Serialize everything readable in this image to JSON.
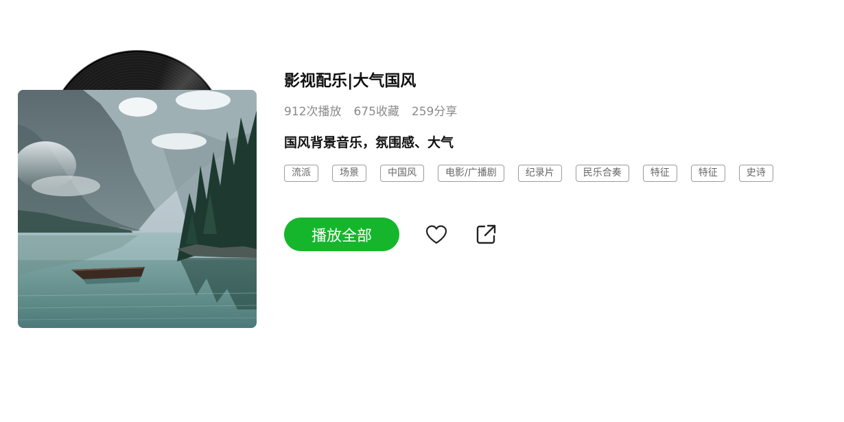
{
  "playlist": {
    "title": "影视配乐|大气国风",
    "stats": {
      "plays": "912次播放",
      "favorites": "675收藏",
      "shares": "259分享"
    },
    "description": "国风背景音乐，氛围感、大气",
    "tags": [
      "流派",
      "场景",
      "中国风",
      "电影/广播剧",
      "纪录片",
      "民乐合奏",
      "特征",
      "特征",
      "史诗"
    ],
    "cover": {
      "subject": "lake with mountains, pine trees and rowboat",
      "vinyl_icon": "vinyl-record"
    }
  },
  "actions": {
    "play_all_label": "播放全部",
    "play_all_color": "#15b62b",
    "like_icon": "heart-outline-icon",
    "share_icon": "external-share-icon"
  }
}
